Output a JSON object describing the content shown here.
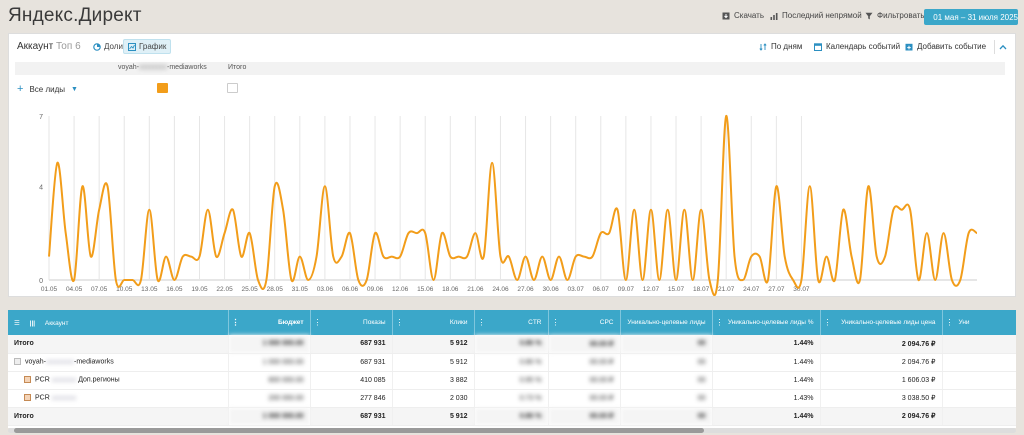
{
  "app": {
    "title": "Яндекс.Директ"
  },
  "toolbar": {
    "download": "Скачать",
    "attribution": "Последний непрямой",
    "filter": "Фильтровать",
    "date_range": "01 мая – 31 июля 2025"
  },
  "panel": {
    "title": "Аккаунт",
    "title_suffix": "Топ 6",
    "view_shares": "Доли",
    "view_chart": "График",
    "by_days": "По дням",
    "events_calendar": "Календарь событий",
    "add_event": "Добавить событие"
  },
  "legend": {
    "series_prefix": "voyah-",
    "series_hidden": "xxxxxxxx",
    "series_suffix": "-mediaworks",
    "total": "Итого"
  },
  "metric_selector": {
    "label": "Все лиды"
  },
  "colors": {
    "series": "#f29d1a",
    "accent": "#3ba7c9",
    "total_swatch": "#cccccc"
  },
  "chart_data": {
    "type": "line",
    "ylim": [
      0,
      7
    ],
    "y_ticks": [
      "0",
      "4",
      "7"
    ],
    "x_tick_labels": [
      "01.05",
      "04.05",
      "07.05",
      "10.05",
      "13.05",
      "16.05",
      "19.05",
      "22.05",
      "25.05",
      "28.05",
      "31.05",
      "03.06",
      "06.06",
      "09.06",
      "12.06",
      "15.06",
      "18.06",
      "21.06",
      "24.06",
      "27.06",
      "30.06",
      "03.07",
      "06.07",
      "09.07",
      "12.07",
      "15.07",
      "18.07",
      "21.07",
      "24.07",
      "27.07",
      "30.07"
    ],
    "series": [
      {
        "values": [
          1,
          5,
          2,
          0,
          4,
          1,
          3,
          4,
          0,
          0,
          0,
          0,
          3,
          0,
          1,
          0,
          1,
          1,
          1,
          3,
          1,
          2,
          3,
          1,
          2,
          0,
          0,
          4,
          3,
          0,
          1,
          0,
          1,
          4,
          1,
          1,
          2,
          0,
          0,
          2,
          1,
          1,
          1,
          2,
          2,
          2,
          0,
          2,
          1,
          1,
          1,
          2,
          1,
          5,
          1,
          1,
          0,
          1,
          0,
          1,
          0,
          1,
          0,
          1,
          1,
          1,
          2,
          2,
          3,
          0,
          3,
          0,
          3,
          0,
          3,
          0,
          3,
          0,
          3,
          0,
          0,
          7,
          1,
          0,
          1,
          1,
          0,
          4,
          1,
          0,
          0,
          4,
          0,
          1,
          0,
          3,
          1,
          0,
          4,
          1,
          1,
          3,
          3,
          3,
          0,
          2,
          0,
          2,
          0,
          0,
          2,
          2
        ]
      }
    ]
  },
  "table": {
    "columns": [
      "Аккаунт",
      "Бюджет",
      "Показы",
      "Клики",
      "CTR",
      "CPC",
      "Уникально-целевые лиды",
      "Уникально-целевые лиды %",
      "Уникально-целевые лиды цена",
      "Уни"
    ],
    "rows": [
      {
        "name": "Итого",
        "budget": "1 000 000.00",
        "impressions": "687 931",
        "clicks": "5 912",
        "ctr": "0.86 %",
        "cpc": "00.00 ₽",
        "leads": "00",
        "leads_pct": "1.44%",
        "lead_price": "2 094.76 ₽"
      },
      {
        "name": "voyah-",
        "name_hidden": "xxxxxxxx",
        "name_suffix": "-mediaworks",
        "budget": "1 000 000.00",
        "impressions": "687 931",
        "clicks": "5 912",
        "ctr": "0.86 %",
        "cpc": "00.00 ₽",
        "leads": "00",
        "leads_pct": "1.44%",
        "lead_price": "2 094.76 ₽"
      },
      {
        "name": "PCR",
        "name_hidden": "xxxxxxx",
        "name_suffix": "Доп.регионы",
        "budget": "800 000.00",
        "impressions": "410 085",
        "clicks": "3 882",
        "ctr": "0.95 %",
        "cpc": "00.00 ₽",
        "leads": "00",
        "leads_pct": "1.44%",
        "lead_price": "1 606.03 ₽"
      },
      {
        "name": "PCR",
        "name_hidden": "xxxxxxx",
        "budget": "200 000.00",
        "impressions": "277 846",
        "clicks": "2 030",
        "ctr": "0.73 %",
        "cpc": "00.00 ₽",
        "leads": "00",
        "leads_pct": "1.43%",
        "lead_price": "3 038.50 ₽"
      },
      {
        "name": "Итого",
        "budget": "1 000 000.00",
        "impressions": "687 931",
        "clicks": "5 912",
        "ctr": "0.86 %",
        "cpc": "00.00 ₽",
        "leads": "00",
        "leads_pct": "1.44%",
        "lead_price": "2 094.76 ₽"
      }
    ]
  }
}
